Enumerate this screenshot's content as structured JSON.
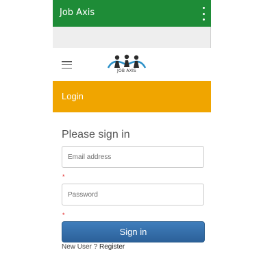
{
  "action_bar": {
    "title": "Job Axis",
    "overflow_icon": "more-vert-icon",
    "background": "#1e8c37"
  },
  "nav": {
    "menu_icon": "hamburger-icon",
    "logo_text": "JOB AXIS"
  },
  "banner": {
    "title": "Login",
    "background": "#f0a500"
  },
  "form": {
    "heading": "Please sign in",
    "email_placeholder": "Email address",
    "email_value": "",
    "password_placeholder": "Password",
    "password_value": "",
    "required_marker": "*",
    "submit_label": "Sign in",
    "submit_color": "#3473b0"
  },
  "register": {
    "prompt": "New User ? ",
    "link_label": "Register"
  }
}
